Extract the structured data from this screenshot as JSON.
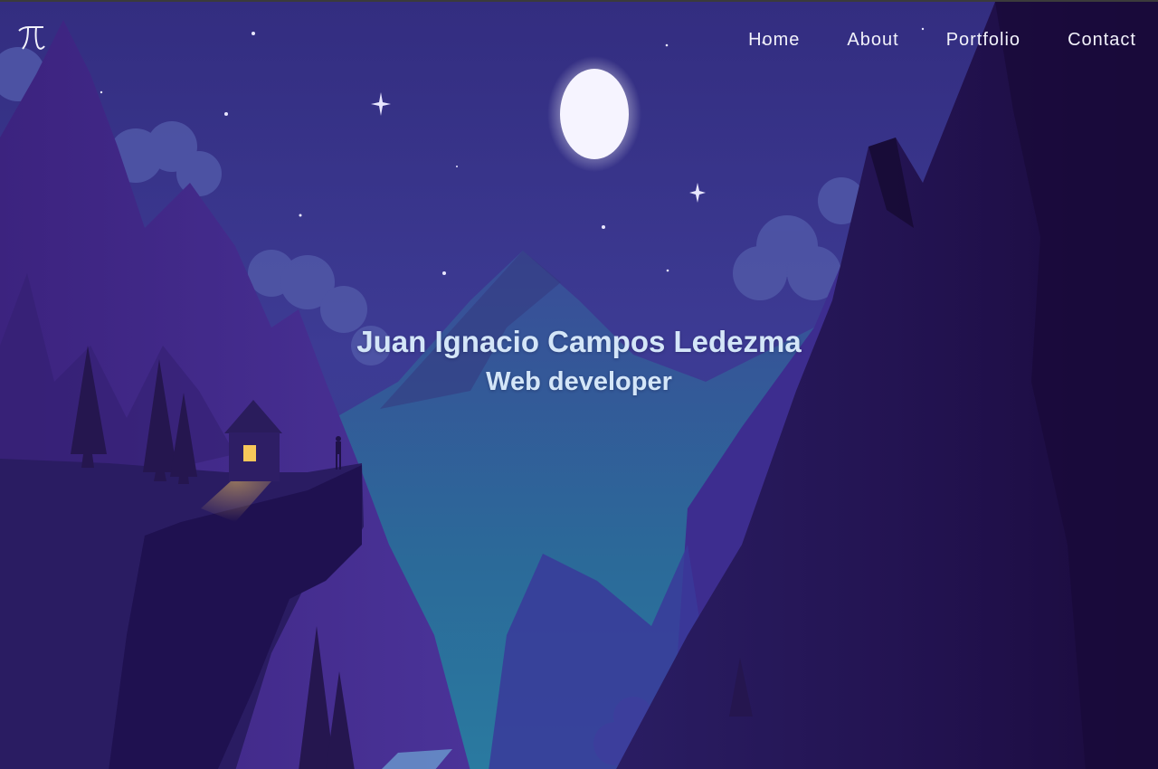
{
  "brand": {
    "logo_icon": "pi-logo-icon"
  },
  "nav": {
    "items": [
      {
        "label": "Home"
      },
      {
        "label": "About"
      },
      {
        "label": "Portfolio"
      },
      {
        "label": "Contact"
      }
    ]
  },
  "hero": {
    "name": "Juan Ignacio Campos Ledezma",
    "role": "Web developer",
    "background": "night-mountain-landscape",
    "colors": {
      "sky_top": "#35307f",
      "sky_mid": "#3f3d96",
      "valley": "#2a6a96",
      "mountain_dark": "#1e0f45",
      "text": "#d4e6f8",
      "nav_text": "#f2f2fb",
      "moon": "#f5f3ff",
      "window_light": "#f7c75a"
    }
  }
}
